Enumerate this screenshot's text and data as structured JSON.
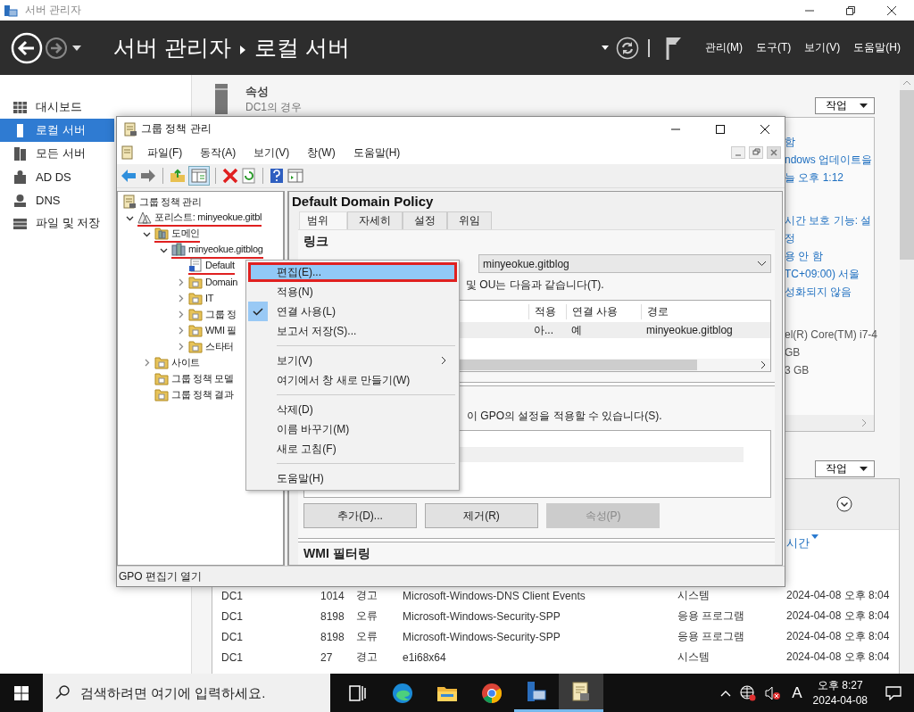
{
  "app_title": "서버 관리자",
  "header": {
    "breadcrumb_root": "서버 관리자",
    "breadcrumb_current": "로컬 서버",
    "menus": [
      "관리(M)",
      "도구(T)",
      "보기(V)",
      "도움말(H)"
    ]
  },
  "nav": [
    {
      "label": "대시보드",
      "kind": "dashboard",
      "selected": false
    },
    {
      "label": "로컬 서버",
      "kind": "local",
      "selected": true
    },
    {
      "label": "모든 서버",
      "kind": "all",
      "selected": false
    },
    {
      "label": "AD DS",
      "kind": "adds",
      "selected": false
    },
    {
      "label": "DNS",
      "kind": "dns",
      "selected": false
    },
    {
      "label": "파일 및 저장",
      "kind": "files",
      "selected": false
    }
  ],
  "properties": {
    "title": "속성",
    "subtitle": "DC1의 경우",
    "task_button": "작업",
    "groups": [
      {
        "kind": "link",
        "lines": [
          "함",
          "ndows 업데이트을",
          "늘 오후 1:12"
        ]
      },
      {
        "kind": "link",
        "lines": [
          "시간 보호 기능: 설",
          "정",
          "용 안 함",
          "TC+09:00) 서울",
          "성화되지 않음"
        ]
      },
      {
        "kind": "plain",
        "lines": [
          "el(R) Core(TM) i7-4",
          "GB",
          "3 GB"
        ]
      }
    ]
  },
  "events": {
    "task_button": "작업",
    "column": "시간",
    "rows": [
      {
        "server": "DC1",
        "id": "1014",
        "level": "경고",
        "source": "Microsoft-Windows-DNS Client Events",
        "log": "시스템",
        "date": "2024-04-08 오후 8:04"
      },
      {
        "server": "DC1",
        "id": "8198",
        "level": "오류",
        "source": "Microsoft-Windows-Security-SPP",
        "log": "응용 프로그램",
        "date": "2024-04-08 오후 8:04"
      },
      {
        "server": "DC1",
        "id": "8198",
        "level": "오류",
        "source": "Microsoft-Windows-Security-SPP",
        "log": "응용 프로그램",
        "date": "2024-04-08 오후 8:04"
      },
      {
        "server": "DC1",
        "id": "27",
        "level": "경고",
        "source": "e1i68x64",
        "log": "시스템",
        "date": "2024-04-08 오후 8:04"
      }
    ]
  },
  "gpm": {
    "title": "그룹 정책 관리",
    "menus": [
      "파일(F)",
      "동작(A)",
      "보기(V)",
      "창(W)",
      "도움말(H)"
    ],
    "tree": [
      {
        "label": "그룹 정책 관리",
        "kind": "console",
        "marked": false,
        "children": [
          {
            "label": "포리스트: minyeokue.gitbl",
            "kind": "forest",
            "expanded": true,
            "marked": true,
            "children": [
              {
                "label": "도메인",
                "kind": "domains",
                "expanded": true,
                "marked": true,
                "children": [
                  {
                    "label": "minyeokue.gitblog",
                    "kind": "domain",
                    "expanded": true,
                    "marked": true,
                    "children": [
                      {
                        "label": "Default",
                        "kind": "gpo",
                        "marked": true
                      },
                      {
                        "label": "Domain",
                        "kind": "folder",
                        "expanded": false,
                        "marked": false
                      },
                      {
                        "label": "IT",
                        "kind": "folder",
                        "expanded": false,
                        "marked": false
                      },
                      {
                        "label": "그룹 정",
                        "kind": "folder",
                        "expanded": false,
                        "marked": false
                      },
                      {
                        "label": "WMI 필",
                        "kind": "folder",
                        "expanded": false,
                        "marked": false
                      },
                      {
                        "label": "스타터",
                        "kind": "folder",
                        "expanded": false,
                        "marked": false
                      }
                    ]
                  }
                ]
              },
              {
                "label": "사이트",
                "kind": "folder",
                "expanded": false,
                "marked": false
              },
              {
                "label": "그룹 정책 모델",
                "kind": "folder",
                "marked": false
              },
              {
                "label": "그룹 정책 결과",
                "kind": "folder",
                "marked": false
              }
            ]
          }
        ]
      }
    ],
    "detail": {
      "title": "Default Domain Policy",
      "tabs": [
        {
          "label": "범위",
          "selected": true
        },
        {
          "label": "자세히",
          "selected": false
        },
        {
          "label": "설정",
          "selected": false
        },
        {
          "label": "위임",
          "selected": false
        }
      ],
      "links_heading": "링크",
      "location": "minyeokue.gitblog",
      "links_note": "및 OU는 다음과 같습니다(T).",
      "columns": [
        "적용",
        "연결 사용",
        "경로"
      ],
      "rows": [
        [
          "아...",
          "예",
          "minyeokue.gitblog"
        ]
      ],
      "filter_note": "이 GPO의 설정을 적용할 수 있습니다(S).",
      "buttons": [
        {
          "label": "추가(D)...",
          "disabled": false
        },
        {
          "label": "제거(R)",
          "disabled": false
        },
        {
          "label": "속성(P)",
          "disabled": true
        }
      ],
      "wmi_heading": "WMI 필터링"
    },
    "status": "GPO 편집기 열기"
  },
  "context_menu": [
    {
      "kind": "item",
      "label": "편집(E)...",
      "selected": true,
      "marked": true,
      "checked": false,
      "submenu": false
    },
    {
      "kind": "item",
      "label": "적용(N)",
      "selected": false,
      "marked": false,
      "checked": false,
      "submenu": false
    },
    {
      "kind": "item",
      "label": "연결 사용(L)",
      "selected": false,
      "marked": false,
      "checked": true,
      "submenu": false
    },
    {
      "kind": "item",
      "label": "보고서 저장(S)...",
      "selected": false,
      "marked": false,
      "checked": false,
      "submenu": false
    },
    {
      "kind": "separator"
    },
    {
      "kind": "item",
      "label": "보기(V)",
      "selected": false,
      "marked": false,
      "checked": false,
      "submenu": true
    },
    {
      "kind": "item",
      "label": "여기에서 창 새로 만들기(W)",
      "selected": false,
      "marked": false,
      "checked": false,
      "submenu": false
    },
    {
      "kind": "separator"
    },
    {
      "kind": "item",
      "label": "삭제(D)",
      "selected": false,
      "marked": false,
      "checked": false,
      "submenu": false
    },
    {
      "kind": "item",
      "label": "이름 바꾸기(M)",
      "selected": false,
      "marked": false,
      "checked": false,
      "submenu": false
    },
    {
      "kind": "item",
      "label": "새로 고침(F)",
      "selected": false,
      "marked": false,
      "checked": false,
      "submenu": false
    },
    {
      "kind": "separator"
    },
    {
      "kind": "item",
      "label": "도움말(H)",
      "selected": false,
      "marked": false,
      "checked": false,
      "submenu": false
    }
  ],
  "taskbar": {
    "search_placeholder": "검색하려면 여기에 입력하세요.",
    "apps": [
      {
        "kind": "taskview",
        "running": false,
        "selected": false
      },
      {
        "kind": "edge",
        "running": false,
        "selected": false
      },
      {
        "kind": "explorer",
        "running": false,
        "selected": false
      },
      {
        "kind": "chrome",
        "running": false,
        "selected": false
      },
      {
        "kind": "servermanager",
        "running": true,
        "selected": false
      },
      {
        "kind": "gpm",
        "running": true,
        "selected": true
      }
    ],
    "ime": "A",
    "time": "오후 8:27",
    "date": "2024-04-08"
  }
}
